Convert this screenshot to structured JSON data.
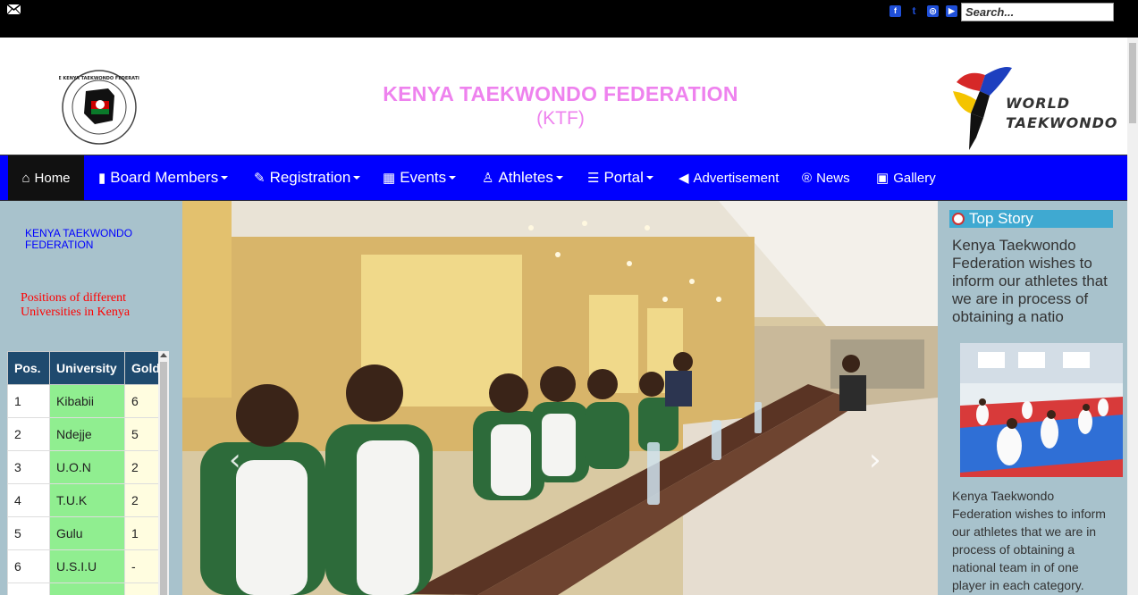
{
  "topbar": {
    "mail_icon": "envelope-icon",
    "social_icons": [
      "facebook-icon",
      "twitter-icon",
      "instagram-icon",
      "youtube-icon"
    ],
    "search_placeholder": "Search..."
  },
  "header": {
    "title": "KENYA TAEKWONDO FEDERATION",
    "subtitle": "(KTF)",
    "left_logo_text": "THE KENYA TAEKWONDO FEDERATION",
    "right_logo_line1": "WORLD",
    "right_logo_line2": "TAEKWONDO"
  },
  "nav": {
    "items": [
      {
        "label": "Home",
        "icon": "home-icon"
      },
      {
        "label": "Board Members",
        "icon": "book-icon"
      },
      {
        "label": "Registration",
        "icon": "pencil-icon"
      },
      {
        "label": "Events",
        "icon": "calendar-icon"
      },
      {
        "label": "Athletes",
        "icon": "user-icon"
      },
      {
        "label": "Portal",
        "icon": "list-icon"
      },
      {
        "label": "Advertisement",
        "icon": "megaphone-icon"
      },
      {
        "label": "News",
        "icon": "registered-icon"
      },
      {
        "label": "Gallery",
        "icon": "picture-icon"
      }
    ]
  },
  "left": {
    "title": "KENYA TAEKWONDO FEDERATION",
    "subtitle": "Positions of different Universities in Kenya",
    "table": {
      "headers": [
        "Pos.",
        "University",
        "Gold"
      ],
      "rows": [
        [
          "1",
          "Kibabii",
          "6"
        ],
        [
          "2",
          "Ndejje",
          "5"
        ],
        [
          "3",
          "U.O.N",
          "2"
        ],
        [
          "4",
          "T.U.K",
          "2"
        ],
        [
          "5",
          "Gulu",
          "1"
        ],
        [
          "6",
          "U.S.I.U",
          "-"
        ],
        [
          "",
          "",
          ""
        ]
      ]
    }
  },
  "carousel": {
    "prev": "‹",
    "next": "›"
  },
  "right": {
    "heading": "Top Story",
    "lead": "Kenya Taekwondo Federation wishes to inform our athletes that we are in process of obtaining a natio",
    "body": "Kenya Taekwondo Federation wishes to inform our athletes that we are in process of obtaining a national team in of one player in each category."
  },
  "colors": {
    "nav_bg": "#0000ff",
    "title": "#ee82ee",
    "sidebar_bg": "#a8c2cc",
    "table_header": "#1f4a6e",
    "university_cell": "#90ee90"
  }
}
